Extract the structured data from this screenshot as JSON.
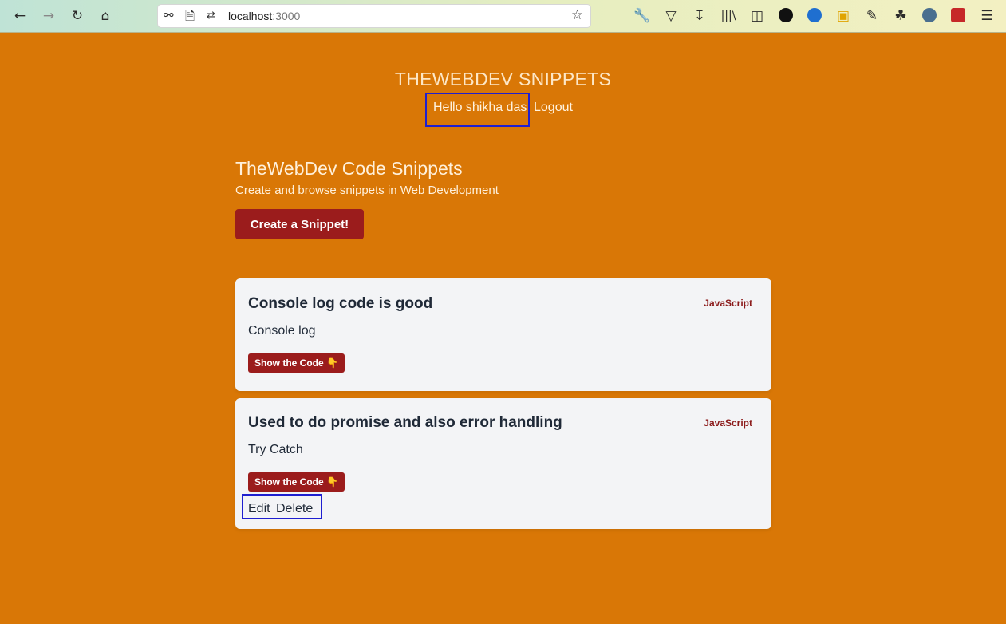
{
  "browser": {
    "url_host": "localhost",
    "url_port": ":3000",
    "icons": [
      "back-icon",
      "forward-icon",
      "reload-icon",
      "home-icon",
      "shield-icon",
      "page-icon",
      "permissions-icon",
      "bookmark-star-icon",
      "wrench-icon",
      "pocket-icon",
      "download-icon",
      "library-icon",
      "sidebar-icon",
      "extension-twd-icon",
      "extension-globe-icon",
      "extension-monitor-icon",
      "extension-notes-icon",
      "extension-gnome-icon",
      "extension-translate-icon",
      "extension-red-icon",
      "menu-icon"
    ]
  },
  "header": {
    "site_title": "THEWEBDEV SNIPPETS",
    "greeting": "Hello shikha das",
    "logout": "Logout"
  },
  "hero": {
    "title": "TheWebDev Code Snippets",
    "subtitle": "Create and browse snippets in Web Development",
    "create_button": "Create a Snippet!"
  },
  "snippets": [
    {
      "title": "Console log code is good",
      "language": "JavaScript",
      "description": "Console log",
      "button": "Show the Code 👇"
    },
    {
      "title": "Used to do promise and also error handling",
      "language": "JavaScript",
      "description": "Try Catch",
      "button": "Show the Code 👇",
      "edit": "Edit",
      "delete": "Delete"
    }
  ],
  "colors": {
    "page_bg": "#d97706",
    "accent": "#9b1c1c",
    "card_bg": "#f3f4f6",
    "highlight": "#1f1fd0"
  }
}
